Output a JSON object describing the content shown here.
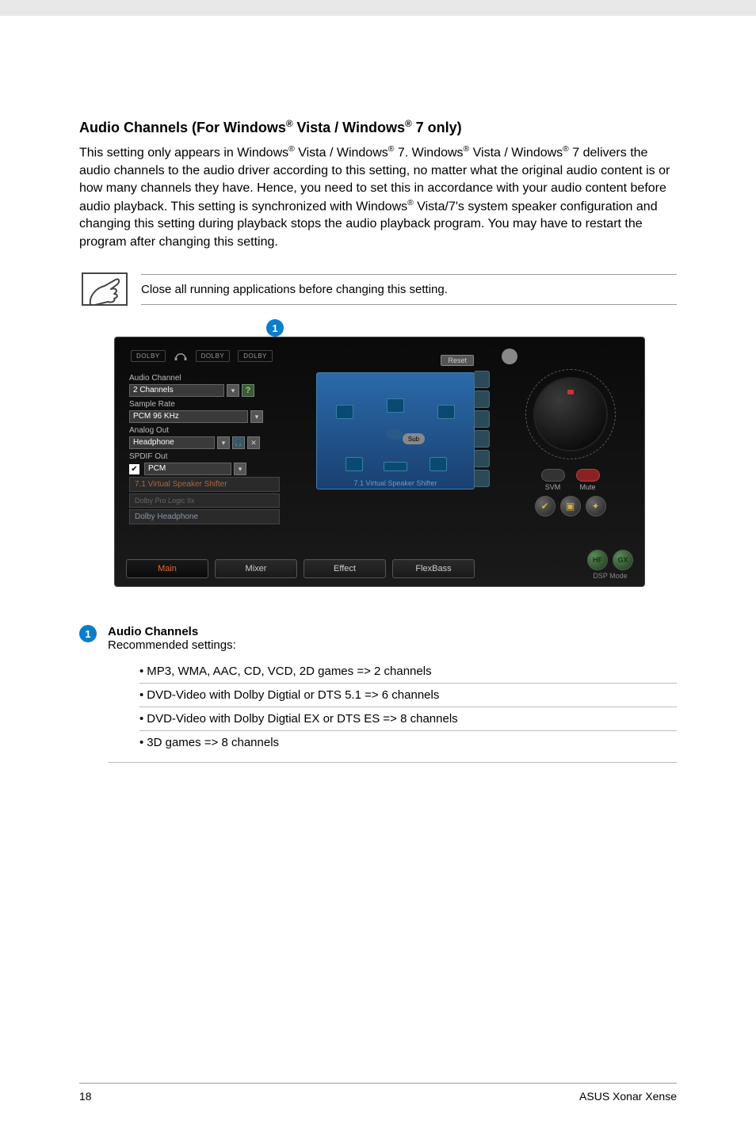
{
  "heading": {
    "pre": "Audio Channels (For Windows",
    "mid1": " Vista / Windows",
    "post": " 7 only)"
  },
  "body": {
    "p1a": "This setting only appears in Windows",
    "p1b": " Vista / Windows",
    "p1c": " 7. Windows",
    "p1d": " Vista / Windows",
    "p1e": " 7 delivers the audio channels to the audio driver according to this setting, no matter what the original audio content is or how many channels they have. Hence, you need to set this in accordance with your audio content before audio playback. This setting is synchronized with Windows",
    "p1f": " Vista/7's system speaker configuration and changing this setting during playback stops the audio playback program. You may have to restart the program after changing this setting."
  },
  "note": "Close all running applications before changing this setting.",
  "callout1": "1",
  "screenshot": {
    "dolby": "DOLBY",
    "groups": {
      "audio_channel": "Audio Channel",
      "audio_channel_value": "2 Channels",
      "sample_rate": "Sample Rate",
      "sample_rate_value": "PCM 96 KHz",
      "analog_out": "Analog Out",
      "analog_out_value": "Headphone",
      "spdif_out": "SPDIF Out",
      "spdif_out_value": "PCM",
      "vss": "7.1 Virtual Speaker Shifter",
      "dplx": "Dolby Pro Logic IIx",
      "dhead": "Dolby Headphone"
    },
    "reset": "Reset",
    "sub": "Sub",
    "speaker_label": "7.1 Virtual Speaker Shifter",
    "svm": "SVM",
    "mute": "Mute",
    "hf": "HF",
    "gx": "GX",
    "dsp_mode": "DSP Mode",
    "tabs": {
      "main": "Main",
      "mixer": "Mixer",
      "effect": "Effect",
      "flexbass": "FlexBass"
    },
    "help": "?",
    "check": "✔"
  },
  "explain": {
    "title": "Audio Channels",
    "sub": "Recommended settings:",
    "items": [
      "MP3, WMA, AAC, CD, VCD, 2D games => 2 channels",
      "DVD-Video with Dolby Digtial or DTS 5.1 => 6 channels",
      "DVD-Video with Dolby Digtial EX or DTS ES => 8 channels",
      "3D games => 8 channels"
    ]
  },
  "footer": {
    "page": "18",
    "product": "ASUS Xonar Xense"
  },
  "reg": "®"
}
